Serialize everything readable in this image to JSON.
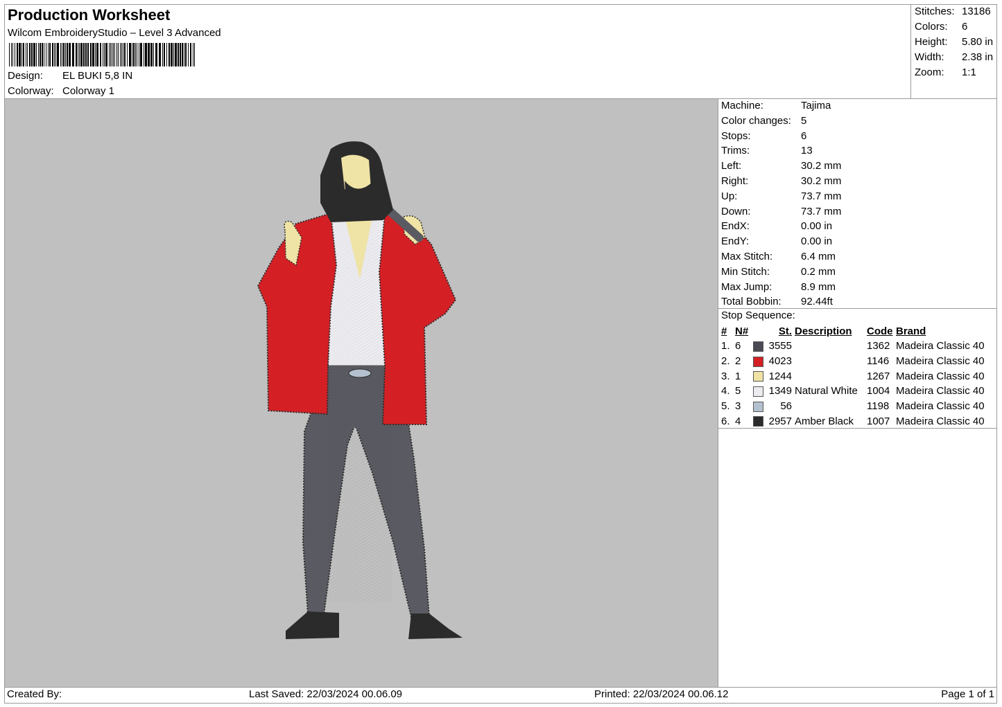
{
  "header": {
    "title": "Production Worksheet",
    "software": "Wilcom EmbroideryStudio – Level 3 Advanced",
    "design_label": "Design:",
    "design_value": "EL BUKI 5,8 IN",
    "colorway_label": "Colorway:",
    "colorway_value": "Colorway 1"
  },
  "stats": [
    {
      "label": "Stitches:",
      "value": "13186"
    },
    {
      "label": "Colors:",
      "value": "6"
    },
    {
      "label": "Height:",
      "value": "5.80 in"
    },
    {
      "label": "Width:",
      "value": "2.38 in"
    },
    {
      "label": "Zoom:",
      "value": "1:1"
    }
  ],
  "machine": [
    {
      "label": "Machine:",
      "value": "Tajima"
    },
    {
      "label": "Color changes:",
      "value": "5"
    },
    {
      "label": "Stops:",
      "value": "6"
    },
    {
      "label": "Trims:",
      "value": "13"
    },
    {
      "label": "Left:",
      "value": "30.2 mm"
    },
    {
      "label": "Right:",
      "value": "30.2 mm"
    },
    {
      "label": "Up:",
      "value": "73.7 mm"
    },
    {
      "label": "Down:",
      "value": "73.7 mm"
    },
    {
      "label": "EndX:",
      "value": "0.00 in"
    },
    {
      "label": "EndY:",
      "value": "0.00 in"
    },
    {
      "label": "Max Stitch:",
      "value": "6.4 mm"
    },
    {
      "label": "Min Stitch:",
      "value": "0.2 mm"
    },
    {
      "label": "Max Jump:",
      "value": "8.9 mm"
    },
    {
      "label": "Total Bobbin:",
      "value": "92.44ft"
    }
  ],
  "stop_sequence": {
    "heading": "Stop Sequence:",
    "columns": [
      "#",
      "N#",
      "St.",
      "Description",
      "Code",
      "Brand"
    ],
    "rows": [
      {
        "num": "1.",
        "n": "6",
        "color": "#4a4a55",
        "st": "3555",
        "desc": "",
        "code": "1362",
        "brand": "Madeira Classic 40"
      },
      {
        "num": "2.",
        "n": "2",
        "color": "#d42025",
        "st": "4023",
        "desc": "",
        "code": "1146",
        "brand": "Madeira Classic 40"
      },
      {
        "num": "3.",
        "n": "1",
        "color": "#efe3a6",
        "st": "1244",
        "desc": "",
        "code": "1267",
        "brand": "Madeira Classic 40"
      },
      {
        "num": "4.",
        "n": "5",
        "color": "#ebebf0",
        "st": "1349",
        "desc": "Natural White",
        "code": "1004",
        "brand": "Madeira Classic 40"
      },
      {
        "num": "5.",
        "n": "3",
        "color": "#b3c1cf",
        "st": "56",
        "desc": "",
        "code": "1198",
        "brand": "Madeira Classic 40"
      },
      {
        "num": "6.",
        "n": "4",
        "color": "#2b2b2b",
        "st": "2957",
        "desc": "Amber Black",
        "code": "1007",
        "brand": "Madeira Classic 40"
      }
    ]
  },
  "footer": {
    "created_by": "Created By:",
    "last_saved": "Last Saved: 22/03/2024 00.06.09",
    "printed": "Printed: 22/03/2024 00.06.12",
    "page": "Page 1 of 1"
  },
  "colors": {
    "canvas_bg": "#c0c0c0",
    "jacket": "#d42025",
    "trousers": "#5a5b62",
    "skin": "#efe3a6",
    "hair": "#2b2b2b",
    "shirt": "#ebebf0",
    "buckle": "#b3c1cf"
  }
}
